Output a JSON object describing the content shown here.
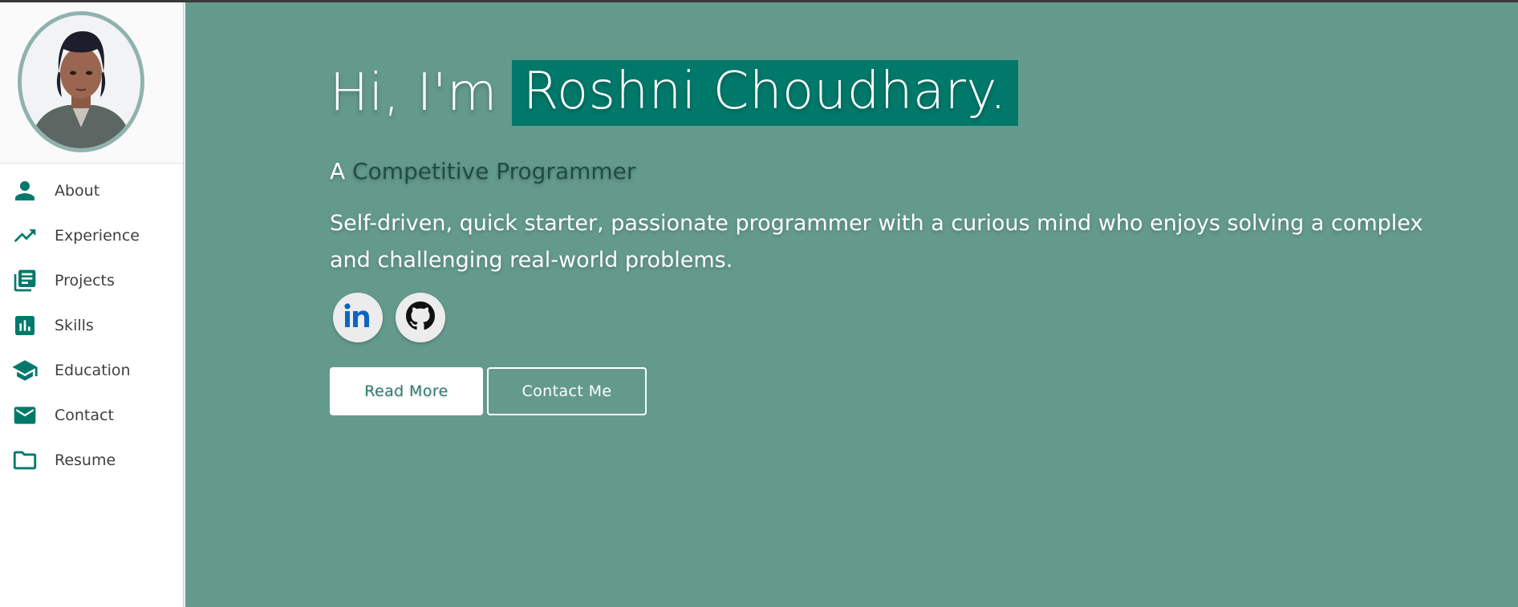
{
  "sidebar": {
    "avatar_alt": "Profile photo",
    "items": [
      {
        "label": "About",
        "icon": "person-icon"
      },
      {
        "label": "Experience",
        "icon": "trending-up-icon"
      },
      {
        "label": "Projects",
        "icon": "library-books-icon"
      },
      {
        "label": "Skills",
        "icon": "bar-chart-icon"
      },
      {
        "label": "Education",
        "icon": "graduation-cap-icon"
      },
      {
        "label": "Contact",
        "icon": "mail-icon"
      },
      {
        "label": "Resume",
        "icon": "folder-icon"
      }
    ]
  },
  "hero": {
    "greeting": "Hi, I'm",
    "name": "Roshni Choudhary.",
    "subtitle_prefix": "A",
    "role": "Competitive Programmer",
    "bio": "Self-driven, quick starter, passionate programmer with a curious mind who enjoys solving a complex and challenging real-world problems.",
    "social": [
      {
        "icon": "linkedin-icon"
      },
      {
        "icon": "github-icon"
      }
    ],
    "buttons": {
      "read_more": "Read More",
      "contact": "Contact Me"
    }
  },
  "colors": {
    "accent": "#00796b",
    "main_bg": "#649a8c",
    "icon": "#00796b"
  }
}
